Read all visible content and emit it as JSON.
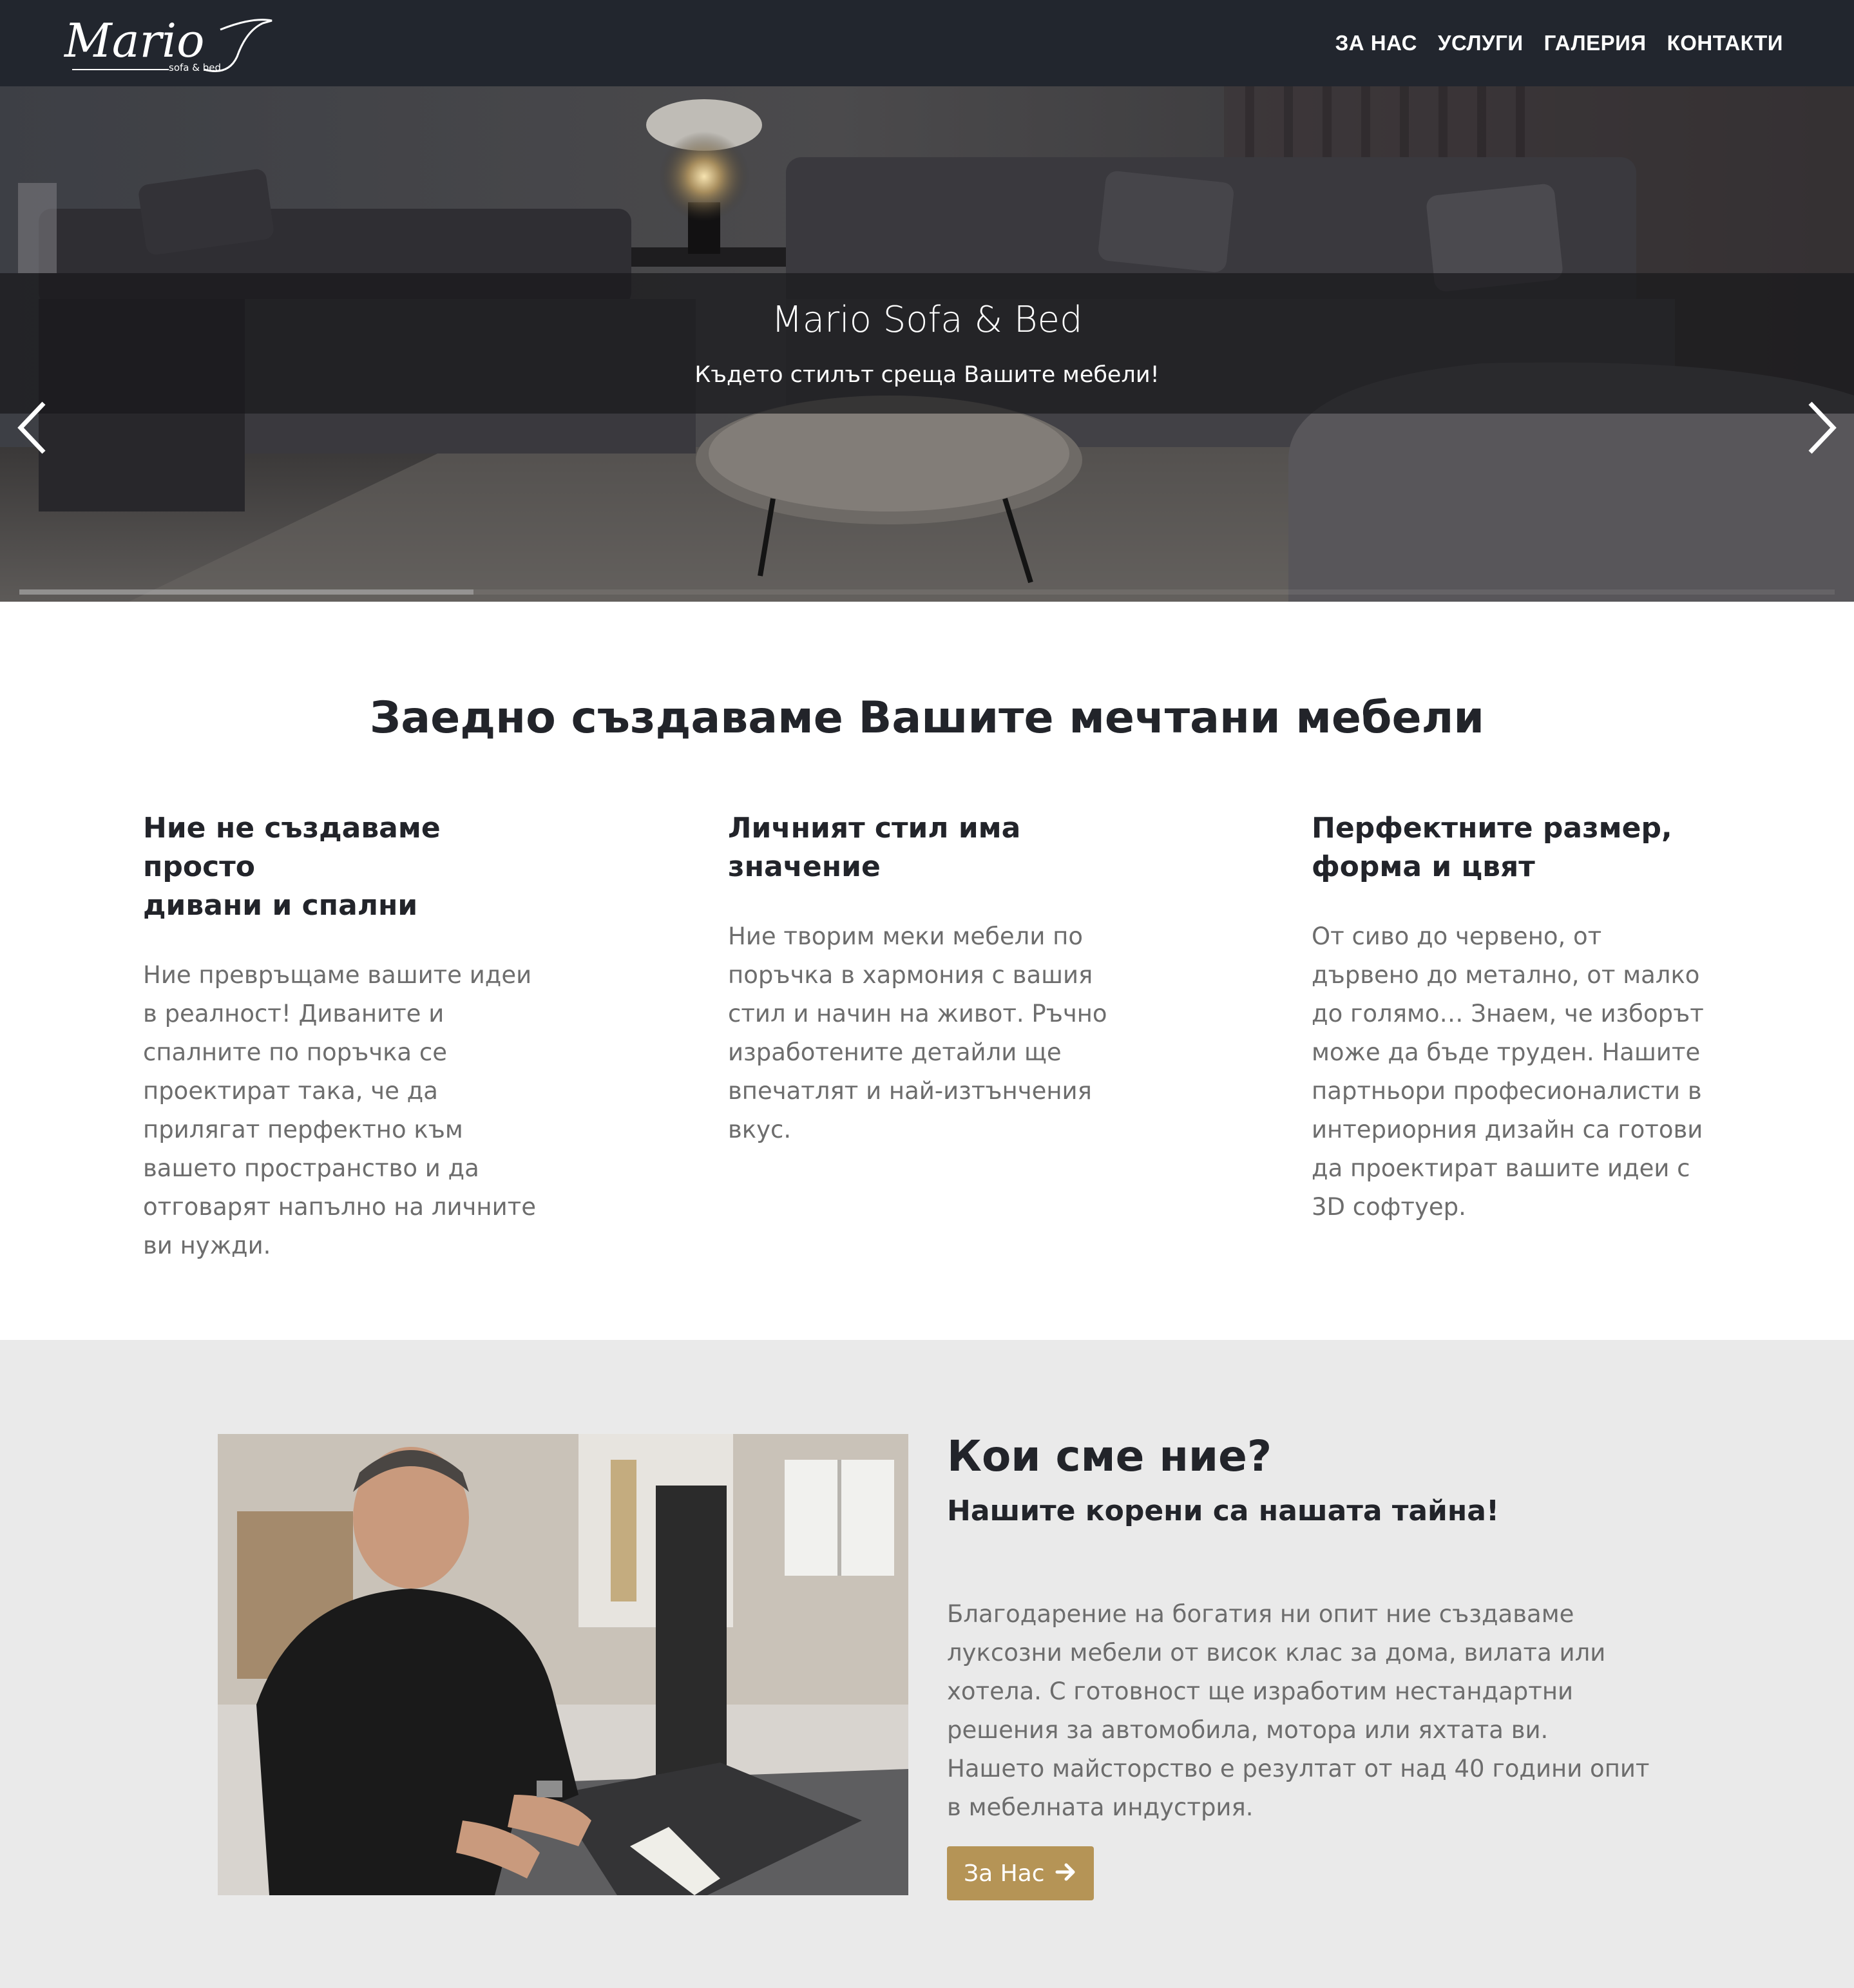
{
  "brand": {
    "logo_text": "Mario",
    "logo_tagline": "sofa & bed"
  },
  "nav": {
    "items": [
      "ЗА НАС",
      "УСЛУГИ",
      "ГАЛЕРИЯ",
      "КОНТАКТИ"
    ]
  },
  "hero": {
    "title": "Mario Sofa & Bed",
    "subtitle": "Където стилът среща Вашите мебели!",
    "slide_progress": 0.25
  },
  "intro": {
    "heading": "Заедно създаваме Вашите мечтани мебели",
    "columns": [
      {
        "title_lines": [
          "Ние не създаваме просто",
          "дивани и спални"
        ],
        "text_lines": [
          "Ние превръщаме вашите идеи",
          "в реалност! Диваните и",
          "спалните по поръчка се",
          "проектират така, че да",
          "прилягат перфектно към",
          "вашето пространство и да",
          "отговарят напълно на личните",
          "ви нужди."
        ]
      },
      {
        "title_lines": [
          "Личният стил има",
          "значение"
        ],
        "text_lines": [
          "Ние творим меки мебели по",
          "поръчка в хармония с вашия",
          "стил и начин на живот. Ръчно",
          "изработените детайли ще",
          "впечатлят и най-изтънчения",
          "вкус."
        ]
      },
      {
        "title_lines": [
          "Перфектните размер,",
          "форма и цвят"
        ],
        "text_lines": [
          "От сиво до червено, от",
          "дървено до метално, от малко",
          "до голямо… Знаем, че изборът",
          "може да бъде труден. Нашите",
          "партньори професионалисти в",
          "интериорния дизайн са готови",
          "да проектират вашите идеи с",
          "3D софтуер."
        ]
      }
    ]
  },
  "about": {
    "title": "Кои сме ние?",
    "subtitle": "Нашите корени са нашата тайна!",
    "text_lines": [
      "Благодарение на богатия ни опит ние създаваме",
      "луксозни мебели от висок клас за дома, вилата или",
      "хотела. С готовност ще изработим нестандартни",
      "решения за автомобила, мотора или яхтата ви.",
      "Нашето майсторство е резултат от над 40 години опит",
      "в мебелната индустрия."
    ],
    "button_label": "За Нас",
    "button_icon": "arrow-right-icon"
  },
  "colors": {
    "navbar": "#22262e",
    "accent": "#b59456",
    "about_bg": "#eaeaea",
    "body_text": "#6d6d6d",
    "heading_text": "#22242a"
  }
}
